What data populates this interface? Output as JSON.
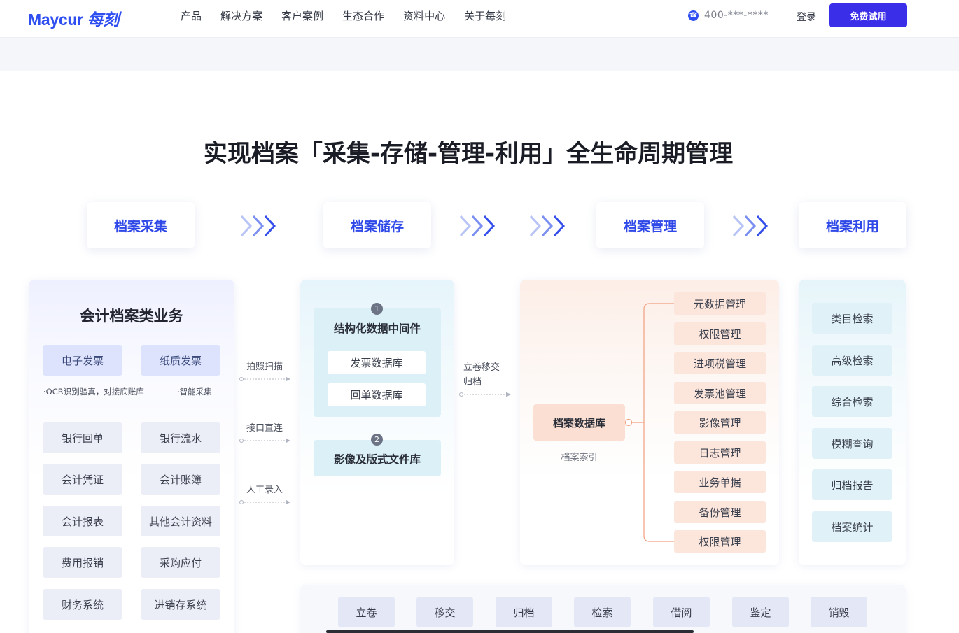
{
  "header": {
    "logo_text": "Maycur",
    "logo_cn": "每刻",
    "nav": [
      "产品",
      "解决方案",
      "客户案例",
      "生态合作",
      "资料中心",
      "关于每刻"
    ],
    "phone": "400-***-****",
    "login": "登录",
    "trial": "免费试用"
  },
  "title": "实现档案「采集-存储-管理-利用」全生命周期管理",
  "stages": [
    "档案采集",
    "档案储存",
    "档案管理",
    "档案利用"
  ],
  "accent": "#2f48e8",
  "collect": {
    "title": "会计档案类业务",
    "invoice_chips": [
      "电子发票",
      "纸质发票"
    ],
    "note_ocr": "·OCR识别验真，对接底账库",
    "note_smart": "·智能采集",
    "chips": [
      "银行回单",
      "银行流水",
      "会计凭证",
      "会计账簿",
      "会计报表",
      "其他会计资料",
      "费用报销",
      "采购应付",
      "财务系统",
      "进销存系统"
    ]
  },
  "flows": [
    "拍照扫描",
    "接口直连",
    "人工录入"
  ],
  "storage": {
    "badge1": "1",
    "title1": "结构化数据中间件",
    "inner": [
      "发票数据库",
      "回单数据库"
    ],
    "badge2": "2",
    "title2": "影像及版式文件库"
  },
  "transfer_label_1": "立卷移交",
  "transfer_label_2": "归档",
  "manage": {
    "db": "档案数据库",
    "db_sub": "档案索引",
    "items": [
      "元数据管理",
      "权限管理",
      "进项税管理",
      "发票池管理",
      "影像管理",
      "日志管理",
      "业务单据",
      "备份管理",
      "权限管理"
    ]
  },
  "use": {
    "items": [
      "类目检索",
      "高级检索",
      "综合检索",
      "模糊查询",
      "归档报告",
      "档案统计"
    ]
  },
  "lifecycle": [
    "立卷",
    "移交",
    "归档",
    "检索",
    "借阅",
    "鉴定",
    "销毁"
  ]
}
